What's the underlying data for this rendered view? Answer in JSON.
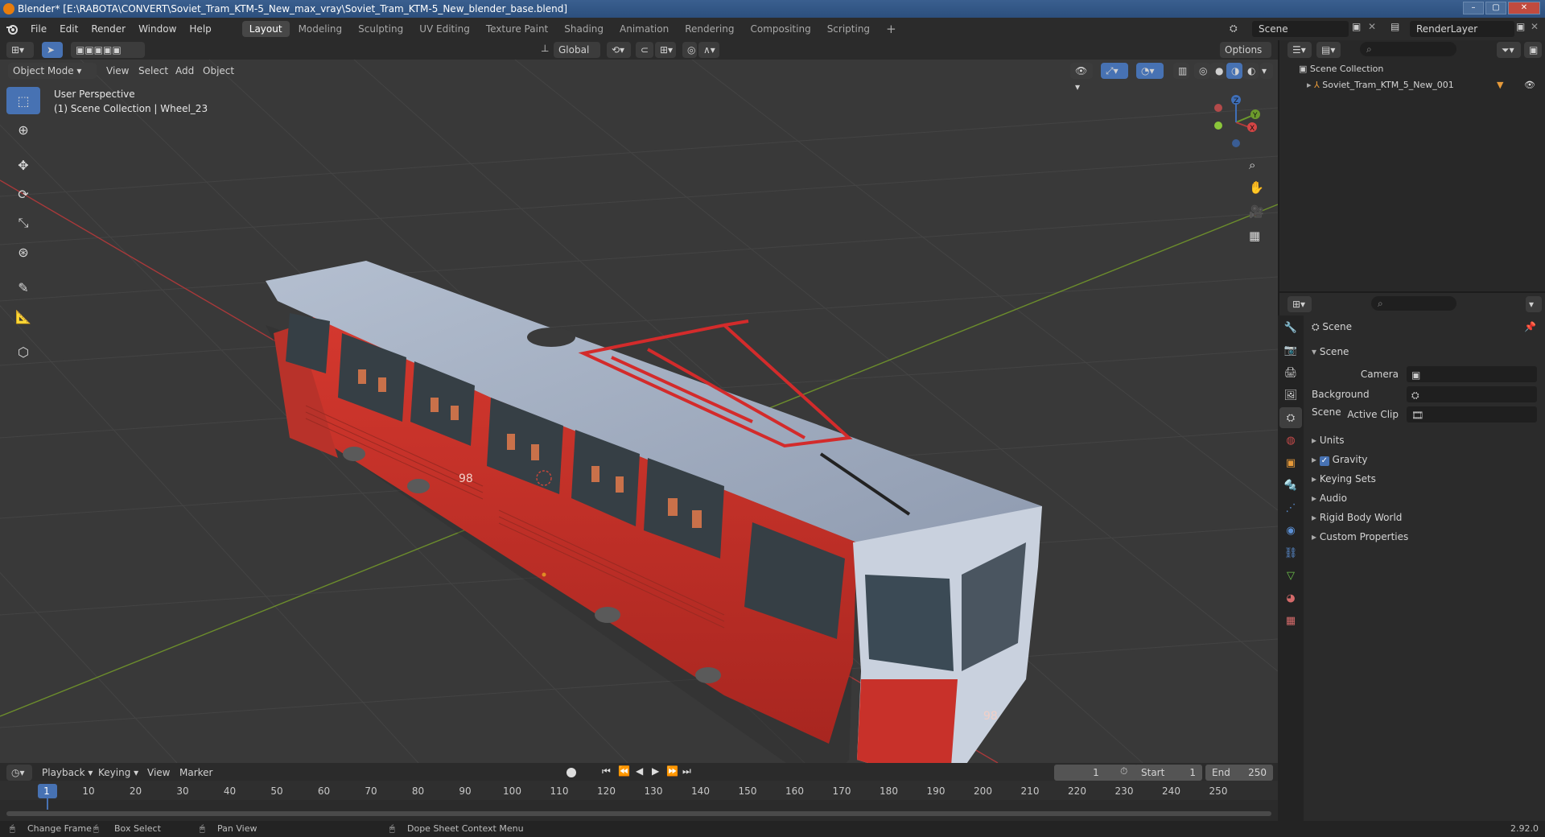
{
  "window": {
    "title": "Blender* [E:\\RABOTA\\CONVERT\\Soviet_Tram_KTM-5_New_max_vray\\Soviet_Tram_KTM-5_New_blender_base.blend]"
  },
  "menu": [
    "File",
    "Edit",
    "Render",
    "Window",
    "Help"
  ],
  "workspaces": [
    {
      "label": "Layout",
      "active": true
    },
    {
      "label": "Modeling"
    },
    {
      "label": "Sculpting"
    },
    {
      "label": "UV Editing"
    },
    {
      "label": "Texture Paint"
    },
    {
      "label": "Shading"
    },
    {
      "label": "Animation"
    },
    {
      "label": "Rendering"
    },
    {
      "label": "Compositing"
    },
    {
      "label": "Scripting"
    }
  ],
  "scene_selector": {
    "value": "Scene"
  },
  "renderlayer_selector": {
    "value": "RenderLayer"
  },
  "tool_header": {
    "transform_orientation": "Global",
    "options_label": "Options"
  },
  "view_header": {
    "mode": "Object Mode",
    "menus": [
      "View",
      "Select",
      "Add",
      "Object"
    ]
  },
  "viewport": {
    "perspective_label": "User Perspective",
    "collection_label": "(1) Scene Collection | Wheel_23",
    "gizmo_axes": {
      "x": "X",
      "y": "Y",
      "z": "Z"
    },
    "tram_number": "98"
  },
  "outliner": {
    "root": "Scene Collection",
    "items": [
      {
        "label": "Soviet_Tram_KTM_5_New_001"
      }
    ]
  },
  "properties": {
    "header": "Scene",
    "section": "Scene",
    "fields": [
      {
        "label": "Camera"
      },
      {
        "label": "Background Scene"
      },
      {
        "label": "Active Clip"
      }
    ],
    "panels": [
      {
        "label": "Units"
      },
      {
        "label": "Gravity",
        "checkbox": true
      },
      {
        "label": "Keying Sets"
      },
      {
        "label": "Audio"
      },
      {
        "label": "Rigid Body World"
      },
      {
        "label": "Custom Properties"
      }
    ]
  },
  "timeline": {
    "menus": [
      "Playback",
      "Keying",
      "View",
      "Marker"
    ],
    "current_frame": "1",
    "start_label": "Start",
    "start_value": "1",
    "end_label": "End",
    "end_value": "250",
    "ticks": [
      "1",
      "10",
      "20",
      "30",
      "40",
      "50",
      "60",
      "70",
      "80",
      "90",
      "100",
      "110",
      "120",
      "130",
      "140",
      "150",
      "160",
      "170",
      "180",
      "190",
      "200",
      "210",
      "220",
      "230",
      "240",
      "250"
    ]
  },
  "statusbar": {
    "change_frame": "Change Frame",
    "box_select": "Box Select",
    "pan_view": "Pan View",
    "context_menu": "Dope Sheet Context Menu",
    "version": "2.92.0"
  },
  "colors": {
    "accent": "#4772b3",
    "tram_red": "#c8312a",
    "tram_roof": "#9aa6b8",
    "pantograph": "#d32b2b"
  }
}
